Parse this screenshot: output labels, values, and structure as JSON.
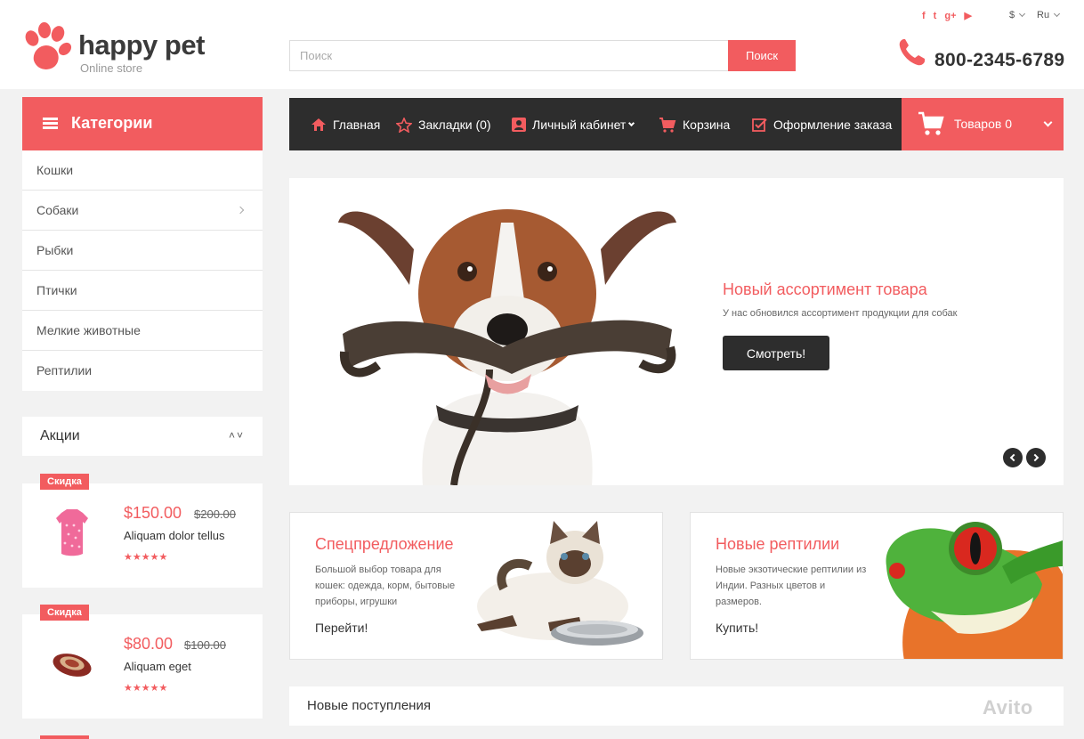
{
  "brand": {
    "name": "happy pet",
    "tagline": "Online store"
  },
  "topbar": {
    "social": [
      "facebook-icon",
      "twitter-icon",
      "google-plus-icon",
      "youtube-icon"
    ],
    "social_glyphs": [
      "f",
      "t",
      "g+",
      "▶"
    ],
    "currency": "$",
    "language": "Ru"
  },
  "search": {
    "placeholder": "Поиск",
    "button": "Поиск"
  },
  "phone": {
    "number": "800-2345-6789"
  },
  "categories": {
    "title": "Категории",
    "items": [
      "Кошки",
      "Собаки",
      "Рыбки",
      "Птички",
      "Мелкие животные",
      "Рептилии"
    ]
  },
  "nav": {
    "home": "Главная",
    "bookmarks": "Закладки (0)",
    "account": "Личный кабинет",
    "cart": "Корзина",
    "checkout": "Оформление заказа"
  },
  "cart": {
    "label": "Товаров 0"
  },
  "slider": {
    "title": "Новый ассортимент товара",
    "text": "У нас обновился ассортимент продукции для собак",
    "button": "Смотреть!"
  },
  "banners": [
    {
      "title": "Спецпредложение",
      "text": "Большой выбор товара для кошек: одежда, корм, бытовые приборы, игрушки",
      "link": "Перейти!"
    },
    {
      "title": "Новые рептилии",
      "text": "Новые экзотические рептилии из Индии. Разных цветов и размеров.",
      "link": "Купить!"
    }
  ],
  "promos": {
    "title": "Акции",
    "products": [
      {
        "badge": "Скидка",
        "price": "$150.00",
        "old_price": "$200.00",
        "name": "Aliquam dolor tellus",
        "stars": "★★★★★"
      },
      {
        "badge": "Скидка",
        "price": "$80.00",
        "old_price": "$100.00",
        "name": "Aliquam eget",
        "stars": "★★★★★"
      }
    ]
  },
  "new_arrivals": {
    "title": "Новые поступления"
  },
  "watermark": "Avito",
  "colors": {
    "accent": "#f25c5f",
    "dark": "#2d2d2d",
    "background": "#f2f2f2"
  }
}
